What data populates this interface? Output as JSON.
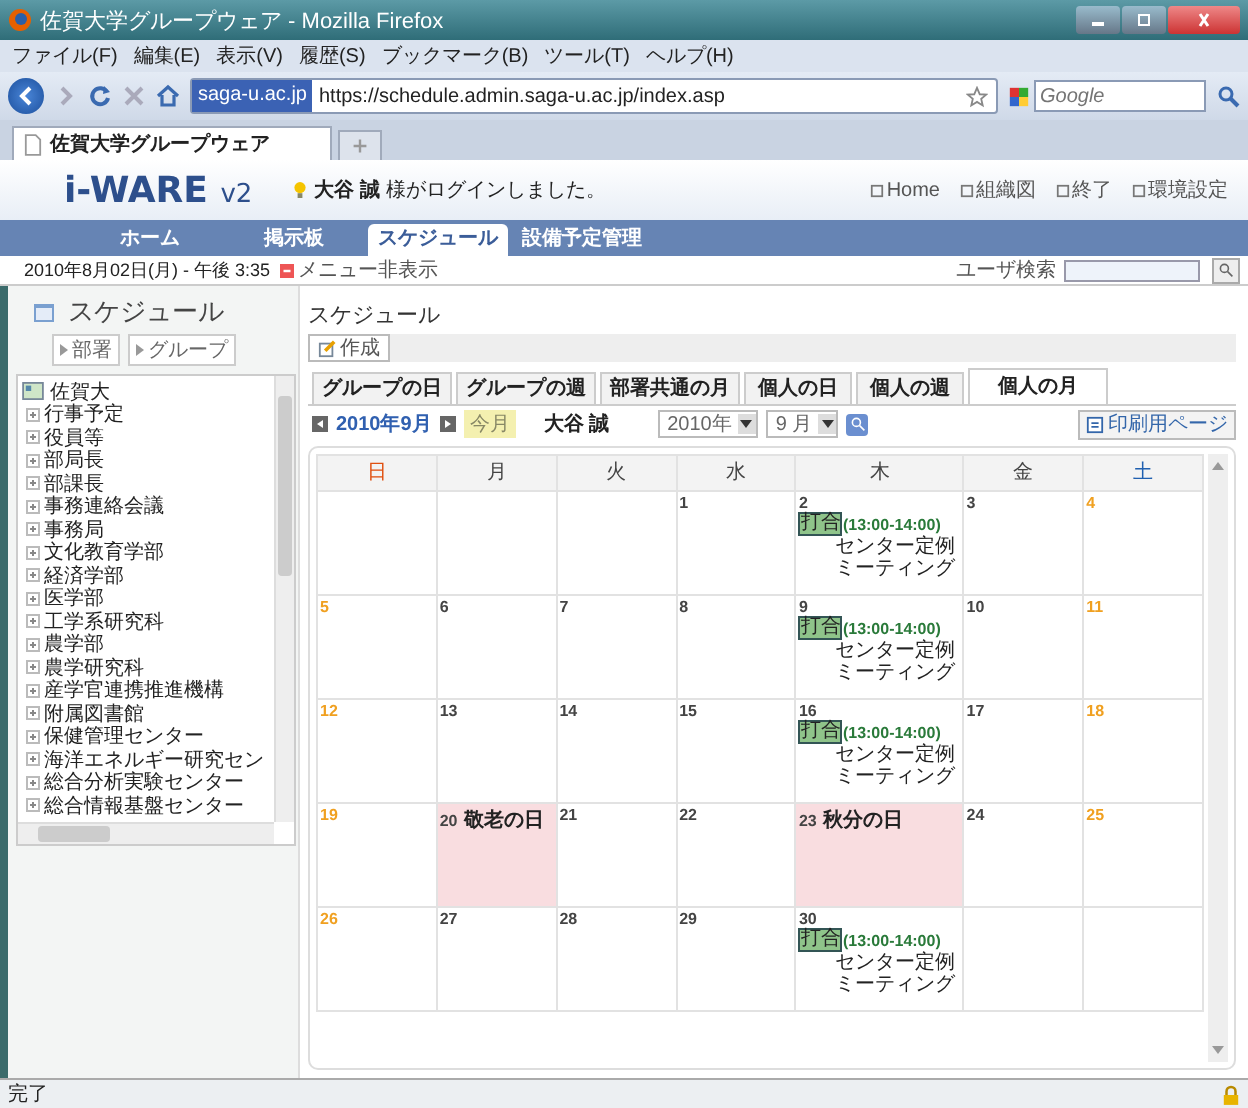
{
  "window": {
    "title": "佐賀大学グループウェア - Mozilla Firefox"
  },
  "menu": [
    "ファイル(F)",
    "編集(E)",
    "表示(V)",
    "履歴(S)",
    "ブックマーク(B)",
    "ツール(T)",
    "ヘルプ(H)"
  ],
  "navigation": {
    "site_badge": "saga-u.ac.jp",
    "url": "https://schedule.admin.saga-u.ac.jp/index.asp",
    "search": {
      "placeholder": "Google"
    }
  },
  "browser_tabs": [
    {
      "label": "佐賀大学グループウェア",
      "selected": true
    }
  ],
  "app": {
    "logo": "i-WARE",
    "version": "v2",
    "login_name": "大谷 誠",
    "login_message": "様がログインしました。",
    "links": [
      "Home",
      "組織図",
      "終了",
      "環境設定"
    ]
  },
  "main_tabs": [
    {
      "label": "ホーム",
      "selected": false
    },
    {
      "label": "掲示板",
      "selected": false
    },
    {
      "label": "スケジュール",
      "selected": true
    },
    {
      "label": "設備予定管理",
      "selected": false
    }
  ],
  "info_bar": {
    "datetime": "2010年8月02日(月) - 午後 3:35",
    "menu_toggle": "メニュー非表示",
    "user_search_label": "ユーザ検索"
  },
  "sidebar": {
    "title": "スケジュール",
    "buttons": [
      "部署",
      "グループ"
    ],
    "tree": [
      {
        "label": "佐賀大",
        "expanded": true,
        "children": [
          {
            "label": "行事予定",
            "expanded": false
          },
          {
            "label": "役員等",
            "expanded": false
          },
          {
            "label": "部局長",
            "expanded": false
          },
          {
            "label": "部課長",
            "expanded": false
          },
          {
            "label": "事務連絡会議",
            "expanded": false
          },
          {
            "label": "事務局",
            "expanded": false
          },
          {
            "label": "文化教育学部",
            "expanded": false
          },
          {
            "label": "経済学部",
            "expanded": false
          },
          {
            "label": "医学部",
            "expanded": false
          },
          {
            "label": "工学系研究科",
            "expanded": false
          },
          {
            "label": "農学部",
            "expanded": false
          },
          {
            "label": "農学研究科",
            "expanded": false
          },
          {
            "label": "産学官連携推進機構",
            "expanded": false
          },
          {
            "label": "附属図書館",
            "expanded": false
          },
          {
            "label": "保健管理センター",
            "expanded": false
          },
          {
            "label": "海洋エネルギー研究セン",
            "expanded": false
          },
          {
            "label": "総合分析実験センター",
            "expanded": false
          },
          {
            "label": "総合情報基盤センター",
            "expanded": false
          }
        ]
      }
    ]
  },
  "content": {
    "title": "スケジュール",
    "create_button": "作成",
    "view_tabs": [
      {
        "label": "グループの日",
        "selected": false
      },
      {
        "label": "グループの週",
        "selected": false
      },
      {
        "label": "部署共通の月",
        "selected": false
      },
      {
        "label": "個人の日",
        "selected": false
      },
      {
        "label": "個人の週",
        "selected": false
      },
      {
        "label": "個人の月",
        "selected": true
      }
    ],
    "month_label": "2010年9月",
    "today_button": "今月",
    "user": "大谷 誠",
    "year_select": "2010年",
    "month_select": "9 月",
    "print_button": "印刷用ページ"
  },
  "calendar": {
    "weekdays": [
      {
        "label": "日",
        "kind": "sun"
      },
      {
        "label": "月",
        "kind": "weekday"
      },
      {
        "label": "火",
        "kind": "weekday"
      },
      {
        "label": "水",
        "kind": "weekday"
      },
      {
        "label": "木",
        "kind": "weekday"
      },
      {
        "label": "金",
        "kind": "weekday"
      },
      {
        "label": "土",
        "kind": "sat"
      }
    ],
    "weeks": [
      {
        "kind": "first",
        "days": [
          {
            "day": "1"
          },
          {
            "day": "2",
            "events": [
              {
                "tag": "打合",
                "time": "(13:00-14:00)",
                "title": "センター定例ミーティング"
              }
            ]
          },
          {
            "day": "3"
          },
          {
            "day": "4"
          }
        ]
      },
      {
        "kind": "full",
        "days": [
          {
            "day": "5"
          },
          {
            "day": "6"
          },
          {
            "day": "7"
          },
          {
            "day": "8"
          },
          {
            "day": "9",
            "events": [
              {
                "tag": "打合",
                "time": "(13:00-14:00)",
                "title": "センター定例ミーティング"
              }
            ]
          },
          {
            "day": "10"
          },
          {
            "day": "11"
          }
        ]
      },
      {
        "kind": "full",
        "days": [
          {
            "day": "12"
          },
          {
            "day": "13"
          },
          {
            "day": "14"
          },
          {
            "day": "15"
          },
          {
            "day": "16",
            "events": [
              {
                "tag": "打合",
                "time": "(13:00-14:00)",
                "title": "センター定例ミーティング"
              }
            ]
          },
          {
            "day": "17"
          },
          {
            "day": "18"
          }
        ]
      },
      {
        "kind": "full",
        "days": [
          {
            "day": "19"
          },
          {
            "day": "20",
            "holiday": "敬老の日"
          },
          {
            "day": "21"
          },
          {
            "day": "22"
          },
          {
            "day": "23",
            "holiday": "秋分の日"
          },
          {
            "day": "24"
          },
          {
            "day": "25"
          }
        ]
      },
      {
        "kind": "last",
        "days": [
          {
            "day": "26"
          },
          {
            "day": "27"
          },
          {
            "day": "28"
          },
          {
            "day": "29"
          },
          {
            "day": "30",
            "events": [
              {
                "tag": "打合",
                "time": "(13:00-14:00)",
                "title": "センター定例ミーティング"
              }
            ]
          }
        ]
      }
    ]
  },
  "status_bar": {
    "text": "完了"
  }
}
